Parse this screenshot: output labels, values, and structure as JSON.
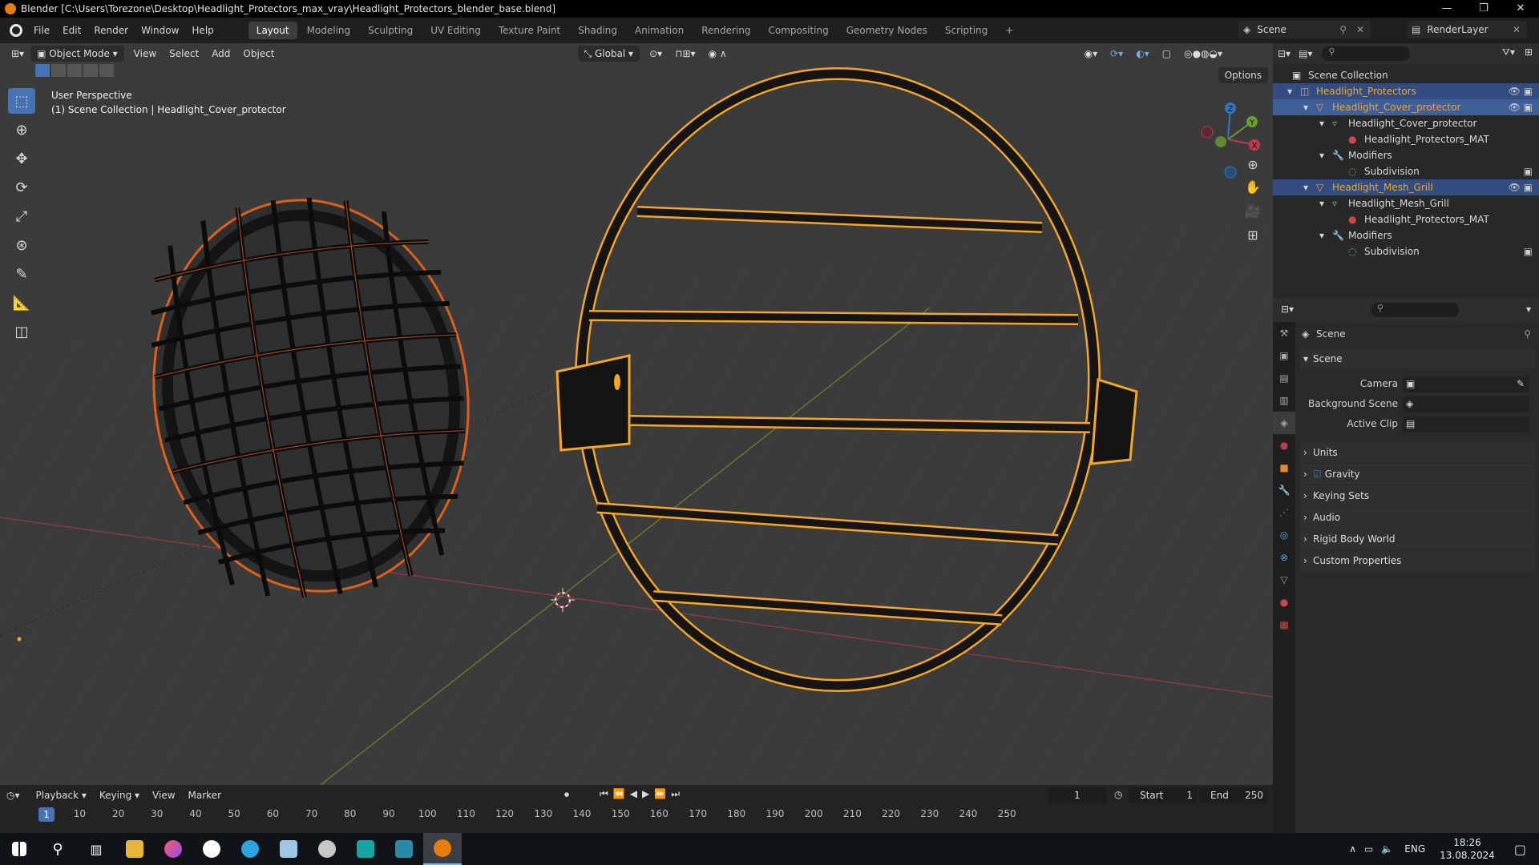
{
  "titlebar": {
    "title": "Blender [C:\\Users\\Torezone\\Desktop\\Headlight_Protectors_max_vray\\Headlight_Protectors_blender_base.blend]",
    "minimize": "—",
    "maximize": "❐",
    "close": "✕"
  },
  "menu": [
    "File",
    "Edit",
    "Render",
    "Window",
    "Help"
  ],
  "workspaces": [
    "Layout",
    "Modeling",
    "Sculpting",
    "UV Editing",
    "Texture Paint",
    "Shading",
    "Animation",
    "Rendering",
    "Compositing",
    "Geometry Nodes",
    "Scripting"
  ],
  "workspace_add": "+",
  "scene_name": "Scene",
  "render_layer": "RenderLayer",
  "viewport": {
    "mode": "Object Mode",
    "menus": [
      "View",
      "Select",
      "Add",
      "Object"
    ],
    "orientation": "Global",
    "options": "Options",
    "perspective": "User Perspective",
    "collection_info": "(1) Scene Collection | Headlight_Cover_protector",
    "gizmo_labels": {
      "x": "X",
      "y": "Y",
      "z": "Z"
    }
  },
  "outliner": {
    "root": "Scene Collection",
    "rows": [
      {
        "label": "Headlight_Protectors",
        "depth": 1,
        "icon": "collection-icon",
        "state": "selected",
        "orange": true
      },
      {
        "label": "Headlight_Cover_protector",
        "depth": 2,
        "icon": "mesh-object-icon",
        "state": "active",
        "orange": true
      },
      {
        "label": "Headlight_Cover_protector",
        "depth": 3,
        "icon": "mesh-data-icon",
        "state": "",
        "orange": false
      },
      {
        "label": "Headlight_Protectors_MAT",
        "depth": 4,
        "icon": "material-icon",
        "state": "",
        "orange": false
      },
      {
        "label": "Modifiers",
        "depth": 3,
        "icon": "wrench-icon",
        "state": "",
        "orange": false
      },
      {
        "label": "Subdivision",
        "depth": 4,
        "icon": "modifier-icon",
        "state": "",
        "orange": false
      },
      {
        "label": "Headlight_Mesh_Grill",
        "depth": 2,
        "icon": "mesh-object-icon",
        "state": "selected",
        "orange": true
      },
      {
        "label": "Headlight_Mesh_Grill",
        "depth": 3,
        "icon": "mesh-data-icon",
        "state": "",
        "orange": false
      },
      {
        "label": "Headlight_Protectors_MAT",
        "depth": 4,
        "icon": "material-icon",
        "state": "",
        "orange": false
      },
      {
        "label": "Modifiers",
        "depth": 3,
        "icon": "wrench-icon",
        "state": "",
        "orange": false
      },
      {
        "label": "Subdivision",
        "depth": 4,
        "icon": "modifier-icon",
        "state": "",
        "orange": false
      }
    ]
  },
  "properties": {
    "context": "Scene",
    "panel": "Scene",
    "fields": [
      {
        "label": "Camera",
        "value": ""
      },
      {
        "label": "Background Scene",
        "value": ""
      },
      {
        "label": "Active Clip",
        "value": ""
      }
    ],
    "collapsed_panels": [
      "Units",
      "Gravity",
      "Keying Sets",
      "Audio",
      "Rigid Body World",
      "Custom Properties"
    ],
    "gravity_enabled": true
  },
  "timeline": {
    "menus": [
      "Playback",
      "Keying",
      "View",
      "Marker"
    ],
    "current_frame": "1",
    "start_label": "Start",
    "start": "1",
    "end_label": "End",
    "end": "250",
    "ticks": [
      "1",
      "10",
      "20",
      "30",
      "40",
      "50",
      "60",
      "70",
      "80",
      "90",
      "100",
      "110",
      "120",
      "130",
      "140",
      "150",
      "160",
      "170",
      "180",
      "190",
      "200",
      "210",
      "220",
      "230",
      "240",
      "250"
    ]
  },
  "taskbar": {
    "language": "ENG",
    "time": "18:26",
    "date": "13.08.2024"
  },
  "colors": {
    "selection_orange": "#f5a623",
    "active_blue": "#4772b3",
    "x_axis": "#c0394b",
    "y_axis": "#6a9e2f",
    "z_axis": "#2f78c0"
  }
}
